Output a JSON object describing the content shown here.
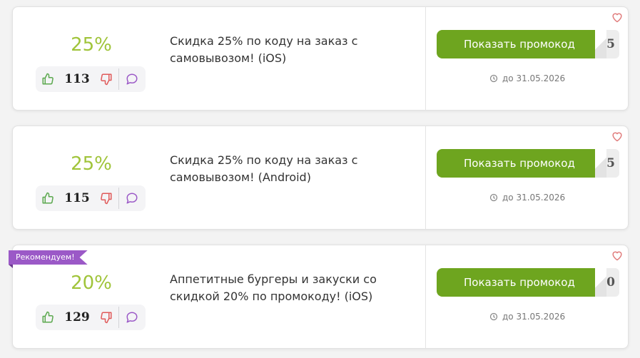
{
  "colors": {
    "discount": "#a0c43a",
    "button": "#6ea51f",
    "ribbon": "#9b59c7",
    "like": "#5ba84e",
    "dislike": "#e05a5a",
    "comment": "#9b59c7"
  },
  "coupons": [
    {
      "discount": "25%",
      "likes": "113",
      "title": "Скидка 25% по коду на заказ с самовывозом! (iOS)",
      "button_label": "Показать промокод",
      "code_peek": "5",
      "expiry": "до 31.05.2026"
    },
    {
      "discount": "25%",
      "likes": "115",
      "title": "Скидка 25% по коду на заказ с самовывозом! (Android)",
      "button_label": "Показать промокод",
      "code_peek": "5",
      "expiry": "до 31.05.2026"
    },
    {
      "badge": "Рекомендуем!",
      "discount": "20%",
      "likes": "129",
      "title": "Аппетитные бургеры и закуски со скидкой 20% по промокоду! (iOS)",
      "button_label": "Показать промокод",
      "code_peek": "0",
      "expiry": "до 31.05.2026"
    }
  ]
}
